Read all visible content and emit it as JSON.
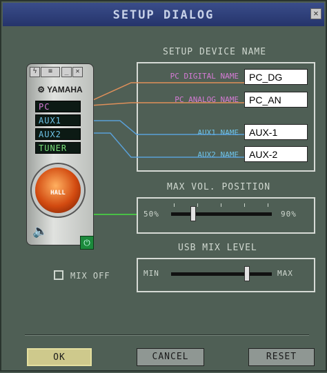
{
  "window": {
    "title": "SETUP DIALOG",
    "close_icon": "close-icon"
  },
  "setup_device_name": {
    "heading": "SETUP DEVICE NAME",
    "fields": [
      {
        "label": "PC DIGITAL NAME",
        "value": "PC_DG",
        "color": "#d67bd6"
      },
      {
        "label": "PC ANALOG NAME",
        "value": "PC_AN",
        "color": "#d67bd6"
      },
      {
        "label": "AUX1 NAME",
        "value": "AUX-1",
        "color": "#6fc3e8"
      },
      {
        "label": "AUX2 NAME",
        "value": "AUX-2",
        "color": "#6fc3e8"
      }
    ]
  },
  "remote": {
    "brand": "YAMAHA",
    "sources": [
      {
        "label": "PC",
        "color": "#d67bd6"
      },
      {
        "label": "AUX1",
        "color": "#6fc3e8"
      },
      {
        "label": "AUX2",
        "color": "#6fc3e8"
      },
      {
        "label": "TUNER",
        "color": "#7be07b"
      }
    ],
    "knob_label": "HALL"
  },
  "max_vol_position": {
    "heading": "MAX VOL. POSITION",
    "min_label": "50%",
    "max_label": "90%",
    "value_fraction": 0.22
  },
  "usb_mix_level": {
    "heading": "USB MIX LEVEL",
    "min_label": "MIN",
    "max_label": "MAX",
    "value_fraction": 0.75
  },
  "mix_off": {
    "label": "MIX OFF",
    "checked": false
  },
  "buttons": {
    "ok": "OK",
    "cancel": "CANCEL",
    "reset": "RESET"
  },
  "colors": {
    "accent_pc": "#e0905a",
    "accent_aux": "#5aa0d8",
    "link_green": "#49c046"
  }
}
